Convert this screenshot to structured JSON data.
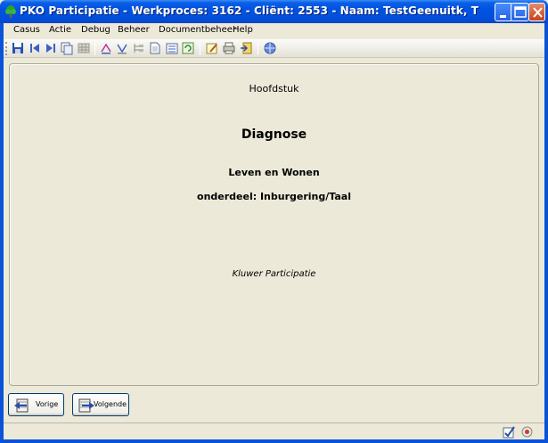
{
  "window": {
    "title": "PKO Participatie - Werkproces: 3162 - Cliënt: 2553 - Naam: TestGeenuitk, T",
    "app_icon": "tree-icon",
    "controls": [
      "minimize-icon",
      "maximize-icon",
      "close-icon"
    ]
  },
  "menu": {
    "items": [
      "Casus",
      "Actie",
      "Debug",
      "Beheer",
      "Documentbeheer",
      "Help"
    ]
  },
  "toolbar": {
    "icons": [
      "save-icon",
      "first-record-icon",
      "last-record-icon",
      "copy-icon",
      "grid-icon",
      "sort-ascending-icon",
      "sort-descending-icon",
      "tree-list-icon",
      "document-icon",
      "list-icon",
      "refresh-icon",
      "edit-document-icon",
      "print-icon",
      "export-icon",
      "web-icon"
    ]
  },
  "content": {
    "chapter_label": "Hoofdstuk",
    "heading": "Diagnose",
    "subheading": "Leven en Wonen",
    "section": "onderdeel: Inburgering/Taal",
    "footer_text": "Kluwer Participatie"
  },
  "navigation": {
    "prev_label": "Vorige",
    "next_label": "Volgende"
  },
  "statusbar": {
    "icons": [
      "check-edit-icon",
      "settings-gear-icon"
    ]
  },
  "colors": {
    "titlebar": "#0053e1",
    "panel_bg": "#ece9d8",
    "close_button": "#c8421a"
  }
}
